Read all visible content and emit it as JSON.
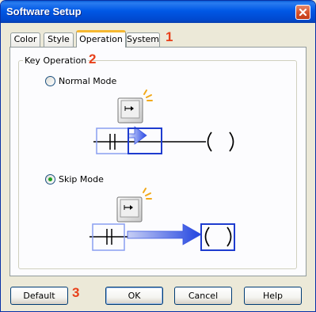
{
  "window": {
    "title": "Software Setup"
  },
  "tabs": [
    {
      "label": "Color",
      "active": false
    },
    {
      "label": "Style",
      "active": false
    },
    {
      "label": "Operation",
      "active": true
    },
    {
      "label": "System",
      "active": false
    }
  ],
  "callouts": {
    "tabs": "1",
    "group": "2",
    "buttons": "3"
  },
  "group": {
    "label": "Key Operation"
  },
  "options": [
    {
      "label": "Normal Mode",
      "selected": false
    },
    {
      "label": "Skip Mode",
      "selected": true
    }
  ],
  "buttons": {
    "default": "Default",
    "ok": "OK",
    "cancel": "Cancel",
    "help": "Help"
  },
  "colors": {
    "title_bar": "#0054e3",
    "accent_highlight": "#1f4fd6",
    "callout": "#e8401a"
  }
}
